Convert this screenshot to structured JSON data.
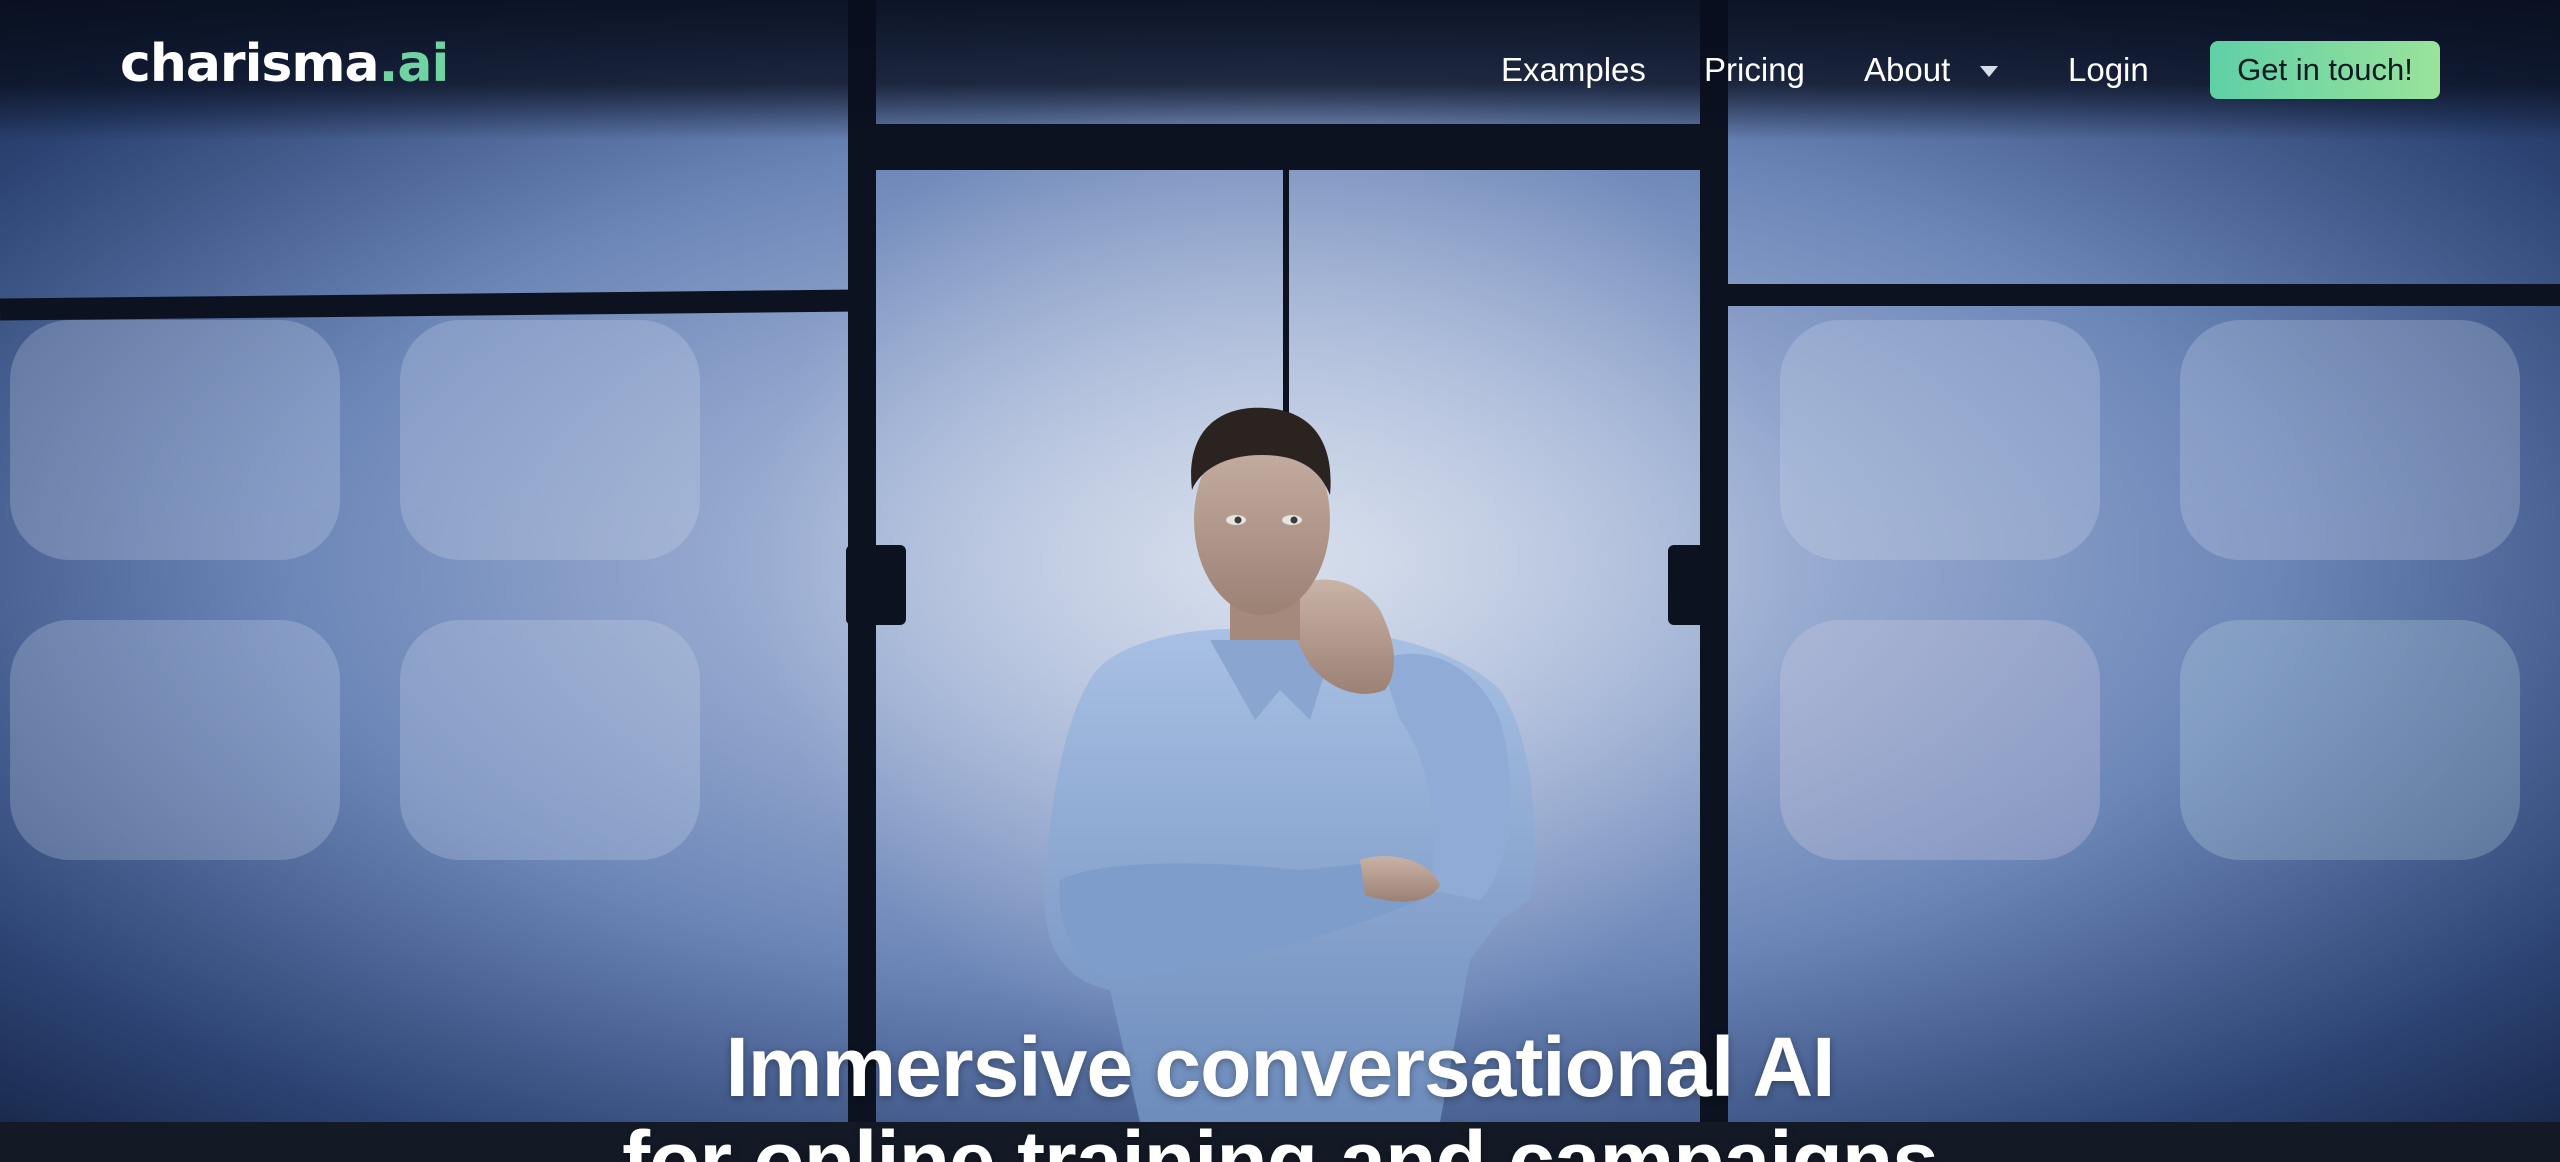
{
  "brand": {
    "logo_text": "charisma",
    "logo_suffix": ".ai",
    "accent_color": "#6fd3a2"
  },
  "nav": {
    "items": [
      {
        "label": "Examples"
      },
      {
        "label": "Pricing"
      },
      {
        "label": "About"
      },
      {
        "label": "Login"
      }
    ],
    "about_icon": "chevron-down-icon",
    "cta_label": "Get in touch!"
  },
  "hero": {
    "headline_line1": "Immersive conversational AI",
    "headline_line2": "for online training and campaigns"
  },
  "colors": {
    "cta_gradient_start": "#5fd0a6",
    "cta_gradient_end": "#9ae39b",
    "background_dark": "#0b1222"
  }
}
